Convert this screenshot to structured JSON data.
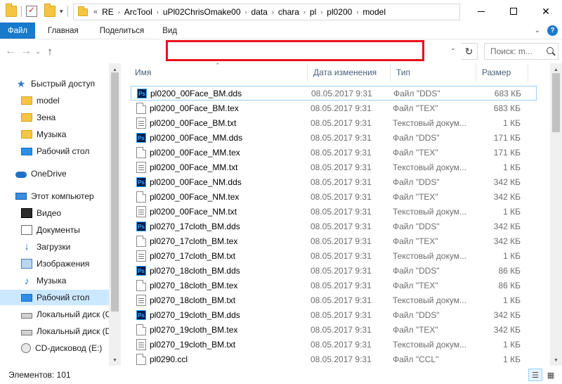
{
  "window": {
    "title": "model",
    "minimize": "—",
    "maximize": "□",
    "close": "✕"
  },
  "ribbon": {
    "tabs": [
      "Файл",
      "Главная",
      "Поделиться",
      "Вид"
    ],
    "help": "?"
  },
  "address": {
    "lead": "«",
    "crumbs": [
      "RE",
      "ArcTool",
      "uPl02ChrisOmake00",
      "data",
      "chara",
      "pl",
      "pl0200",
      "model"
    ],
    "search_placeholder": "Поиск: m..."
  },
  "sidebar": {
    "items": [
      {
        "label": "Быстрый доступ",
        "icon": "star-icon"
      },
      {
        "label": "model",
        "icon": "folder-icon"
      },
      {
        "label": "Зена",
        "icon": "folder-icon"
      },
      {
        "label": "Музыка",
        "icon": "folder-icon"
      },
      {
        "label": "Рабочий стол",
        "icon": "desktop-icon"
      },
      {
        "label": "OneDrive",
        "icon": "cloud-icon"
      },
      {
        "label": "Этот компьютер",
        "icon": "computer-icon"
      },
      {
        "label": "Видео",
        "icon": "video-icon"
      },
      {
        "label": "Документы",
        "icon": "documents-icon"
      },
      {
        "label": "Загрузки",
        "icon": "download-icon"
      },
      {
        "label": "Изображения",
        "icon": "images-icon"
      },
      {
        "label": "Музыка",
        "icon": "music-icon"
      },
      {
        "label": "Рабочий стол",
        "icon": "desktop-icon"
      },
      {
        "label": "Локальный диск (C",
        "icon": "disk-icon"
      },
      {
        "label": "Локальный диск (D",
        "icon": "disk-icon"
      },
      {
        "label": "CD-дисковод (E:)",
        "icon": "cd-icon"
      }
    ],
    "selected_label": "Рабочий стол"
  },
  "columns": {
    "name": "Имя",
    "date": "Дата изменения",
    "type": "Тип",
    "size": "Размер"
  },
  "files": [
    {
      "name": "pl0200_00Face_BM.dds",
      "date": "08.05.2017 9:31",
      "type": "Файл \"DDS\"",
      "size": "683 КБ",
      "kind": "ps"
    },
    {
      "name": "pl0200_00Face_BM.tex",
      "date": "08.05.2017 9:31",
      "type": "Файл \"TEX\"",
      "size": "683 КБ",
      "kind": "file"
    },
    {
      "name": "pl0200_00Face_BM.txt",
      "date": "08.05.2017 9:31",
      "type": "Текстовый докум...",
      "size": "1 КБ",
      "kind": "txt"
    },
    {
      "name": "pl0200_00Face_MM.dds",
      "date": "08.05.2017 9:31",
      "type": "Файл \"DDS\"",
      "size": "171 КБ",
      "kind": "ps"
    },
    {
      "name": "pl0200_00Face_MM.tex",
      "date": "08.05.2017 9:31",
      "type": "Файл \"TEX\"",
      "size": "171 КБ",
      "kind": "file"
    },
    {
      "name": "pl0200_00Face_MM.txt",
      "date": "08.05.2017 9:31",
      "type": "Текстовый докум...",
      "size": "1 КБ",
      "kind": "txt"
    },
    {
      "name": "pl0200_00Face_NM.dds",
      "date": "08.05.2017 9:31",
      "type": "Файл \"DDS\"",
      "size": "342 КБ",
      "kind": "ps"
    },
    {
      "name": "pl0200_00Face_NM.tex",
      "date": "08.05.2017 9:31",
      "type": "Файл \"TEX\"",
      "size": "342 КБ",
      "kind": "file"
    },
    {
      "name": "pl0200_00Face_NM.txt",
      "date": "08.05.2017 9:31",
      "type": "Текстовый докум...",
      "size": "1 КБ",
      "kind": "txt"
    },
    {
      "name": "pl0270_17cloth_BM.dds",
      "date": "08.05.2017 9:31",
      "type": "Файл \"DDS\"",
      "size": "342 КБ",
      "kind": "ps"
    },
    {
      "name": "pl0270_17cloth_BM.tex",
      "date": "08.05.2017 9:31",
      "type": "Файл \"TEX\"",
      "size": "342 КБ",
      "kind": "file"
    },
    {
      "name": "pl0270_17cloth_BM.txt",
      "date": "08.05.2017 9:31",
      "type": "Текстовый докум...",
      "size": "1 КБ",
      "kind": "txt"
    },
    {
      "name": "pl0270_18cloth_BM.dds",
      "date": "08.05.2017 9:31",
      "type": "Файл \"DDS\"",
      "size": "86 КБ",
      "kind": "ps"
    },
    {
      "name": "pl0270_18cloth_BM.tex",
      "date": "08.05.2017 9:31",
      "type": "Файл \"TEX\"",
      "size": "86 КБ",
      "kind": "file"
    },
    {
      "name": "pl0270_18cloth_BM.txt",
      "date": "08.05.2017 9:31",
      "type": "Текстовый докум...",
      "size": "1 КБ",
      "kind": "txt"
    },
    {
      "name": "pl0270_19cloth_BM.dds",
      "date": "08.05.2017 9:31",
      "type": "Файл \"DDS\"",
      "size": "342 КБ",
      "kind": "ps"
    },
    {
      "name": "pl0270_19cloth_BM.tex",
      "date": "08.05.2017 9:31",
      "type": "Файл \"TEX\"",
      "size": "342 КБ",
      "kind": "file"
    },
    {
      "name": "pl0270_19cloth_BM.txt",
      "date": "08.05.2017 9:31",
      "type": "Текстовый докум...",
      "size": "1 КБ",
      "kind": "txt"
    },
    {
      "name": "pl0290.ccl",
      "date": "08.05.2017 9:31",
      "type": "Файл \"CCL\"",
      "size": "1 КБ",
      "kind": "file"
    }
  ],
  "status": {
    "items_count": "Элементов: 101"
  },
  "colors": {
    "accent": "#1979ca",
    "highlight_box": "#e8101a",
    "selection": "#cce8ff"
  }
}
